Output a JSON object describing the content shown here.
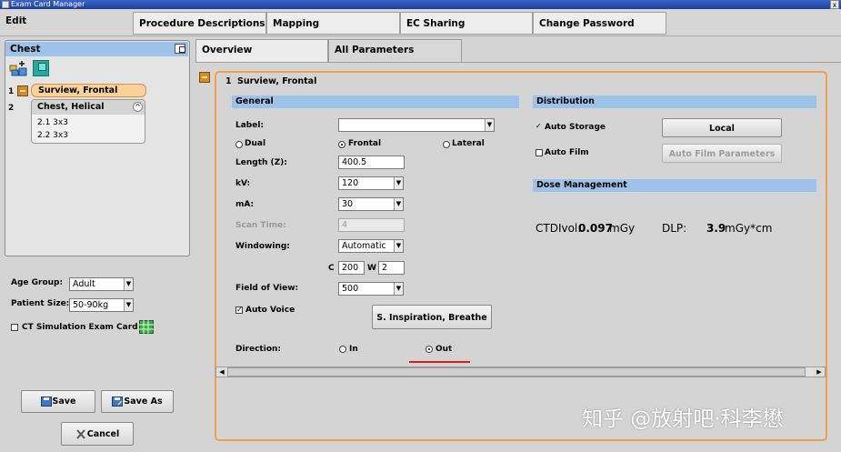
{
  "window": {
    "title": "Exam Card Manager",
    "close_label": "x"
  },
  "top_tabs": {
    "edit": "Edit",
    "procedure_descriptions": "Procedure Descriptions",
    "mapping": "Mapping",
    "ec_sharing": "EC Sharing",
    "change_password": "Change Password"
  },
  "sub_tabs": {
    "overview": "Overview",
    "all_parameters": "All Parameters"
  },
  "exam_card": {
    "title": "Chest",
    "procedures": [
      {
        "number": "1",
        "name": "Surview, Frontal"
      },
      {
        "number": "2",
        "name": "Chest, Helical",
        "sub_items": [
          "2.1 3x3",
          "2.2 3x3"
        ]
      }
    ]
  },
  "patient": {
    "age_group_label": "Age Group:",
    "age_group_value": "Adult",
    "patient_size_label": "Patient Size:",
    "patient_size_value": "50-90kg",
    "ct_sim_label": "CT Simulation Exam Card"
  },
  "bottom_buttons": {
    "save": "Save",
    "save_as": "Save As",
    "cancel": "Cancel"
  },
  "procedure_header": {
    "number": "1",
    "name": "Surview, Frontal"
  },
  "general": {
    "section_title": "General",
    "label_label": "Label:",
    "label_value": "",
    "view_options": [
      "Dual",
      "Frontal",
      "Lateral"
    ],
    "view_selected": "Frontal",
    "length_label": "Length (Z):",
    "length_value": "400.5",
    "kv_label": "kV:",
    "kv_value": "120",
    "ma_label": "mA:",
    "ma_value": "30",
    "scan_time_label": "Scan Time:",
    "scan_time_value": "4",
    "windowing_label": "Windowing:",
    "windowing_value": "Automatic",
    "c_label": "C",
    "c_value": "200",
    "w_label": "W",
    "w_value": "2",
    "fov_label": "Field of View:",
    "fov_value": "500",
    "auto_voice_label": "Auto Voice",
    "auto_voice_checked": true,
    "voice_button": "S. Inspiration, Breathe",
    "direction_label": "Direction:",
    "direction_options": [
      "In",
      "Out"
    ],
    "direction_selected": "Out"
  },
  "distribution": {
    "section_title": "Distribution",
    "auto_storage_label": "Auto Storage",
    "auto_storage_checked": true,
    "local_button": "Local",
    "auto_film_label": "Auto Film",
    "auto_film_checked": false,
    "auto_film_params_button": "Auto Film Parameters"
  },
  "dose": {
    "section_title": "Dose Management",
    "ctdi_label": "CTDIvol:",
    "ctdi_value": "0.097",
    "ctdi_unit": "mGy",
    "dlp_label": "DLP:",
    "dlp_value": "3.9",
    "dlp_unit": "mGy*cm"
  },
  "watermark": "知乎 @放射吧·科李懋",
  "colors": {
    "accent_blue": "#9ec3ea",
    "highlight_orange": "#f0a04b",
    "selected_item": "#f8d298",
    "annotation_red": "#e01818"
  }
}
